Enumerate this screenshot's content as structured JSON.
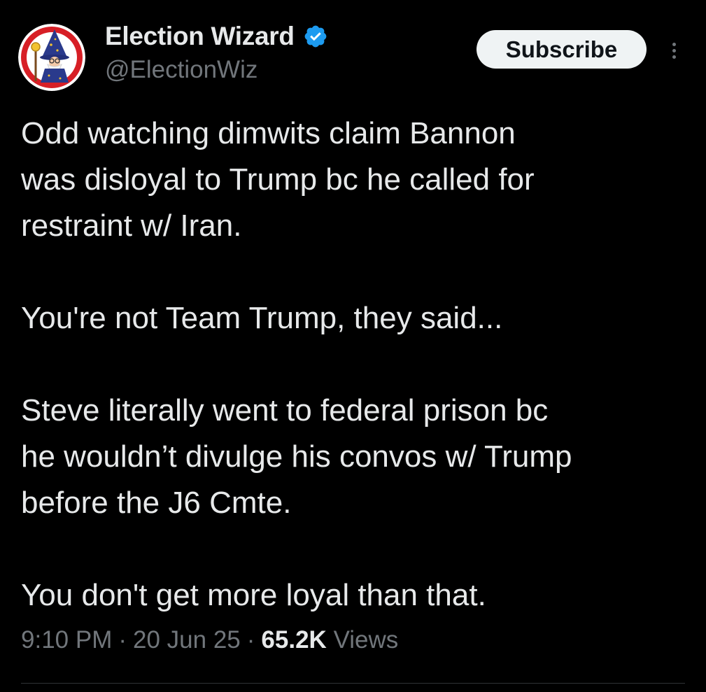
{
  "author": {
    "display_name": "Election Wizard",
    "handle": "@ElectionWiz",
    "verified": true,
    "verified_color": "#1d9bf0",
    "avatar_icon": "wizard-avatar-icon"
  },
  "actions": {
    "subscribe_label": "Subscribe",
    "more_icon": "more-options-icon"
  },
  "tweet": {
    "paragraphs": [
      "Odd watching dimwits claim Bannon\nwas disloyal to Trump bc he called for\nrestraint w/ Iran.",
      "You're not Team Trump, they said...",
      "Steve literally went to federal prison bc\nhe wouldn’t divulge his convos w/ Trump\nbefore the J6 Cmte.",
      "You don't get more loyal than that."
    ],
    "time": "9:10 PM",
    "separator": "·",
    "date": "20 Jun 25",
    "views_count": "65.2K",
    "views_label": "Views"
  },
  "colors": {
    "background": "#000000",
    "text_primary": "#e7e9ea",
    "text_secondary": "#71767b",
    "subscribe_bg": "#eff3f4"
  }
}
